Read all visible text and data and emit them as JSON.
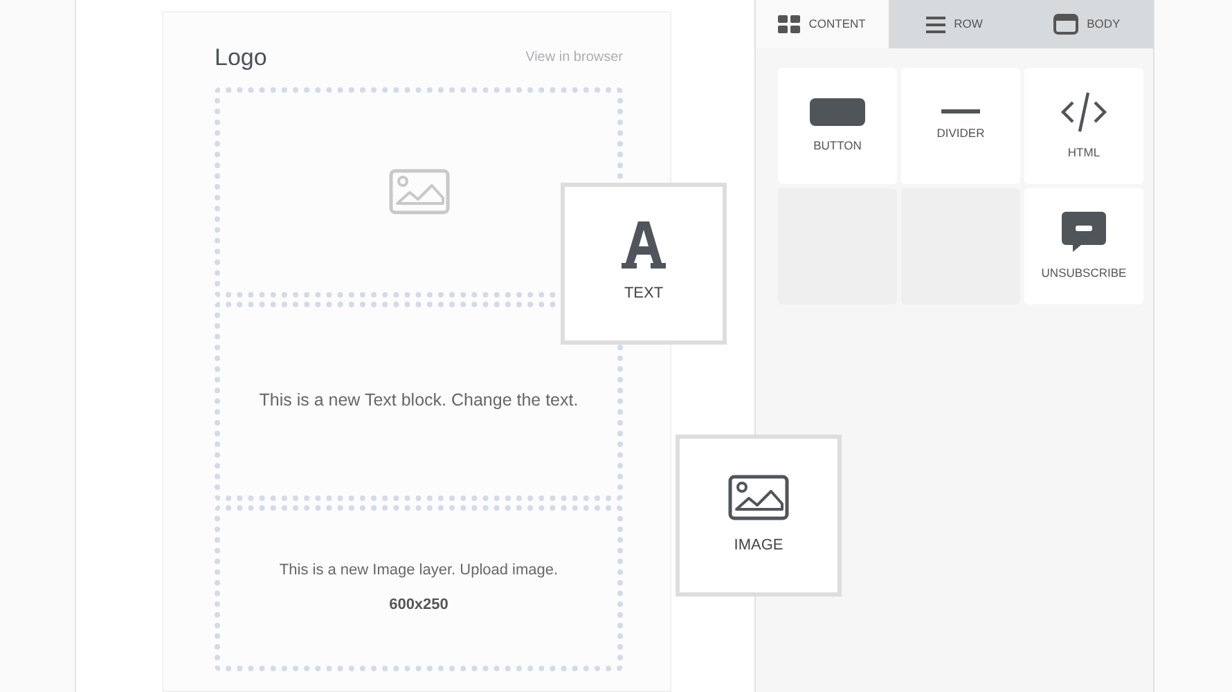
{
  "tabs": [
    {
      "kind": "content",
      "label": "CONTENT",
      "selected": true
    },
    {
      "kind": "row",
      "label": "ROW",
      "selected": false
    },
    {
      "kind": "body",
      "label": "BODY",
      "selected": false
    }
  ],
  "tools": [
    {
      "kind": "button",
      "label": "BUTTON"
    },
    {
      "kind": "divider",
      "label": "DIVIDER"
    },
    {
      "kind": "html",
      "label": "HTML"
    },
    {
      "kind": "empty"
    },
    {
      "kind": "empty"
    },
    {
      "kind": "unsubscribe",
      "label": "UNSUBSCRIBE"
    }
  ],
  "email": {
    "logo": "Logo",
    "view_link": "View in browser",
    "blocks": [
      {
        "kind": "image_placeholder"
      },
      {
        "kind": "text",
        "text": "This is a new Text block. Change the text."
      },
      {
        "kind": "image",
        "text": "This is a new Image layer. Upload image.",
        "size": "600x250"
      }
    ]
  },
  "dragging": [
    {
      "kind": "text",
      "label": "TEXT"
    },
    {
      "kind": "image",
      "label": "IMAGE"
    }
  ]
}
